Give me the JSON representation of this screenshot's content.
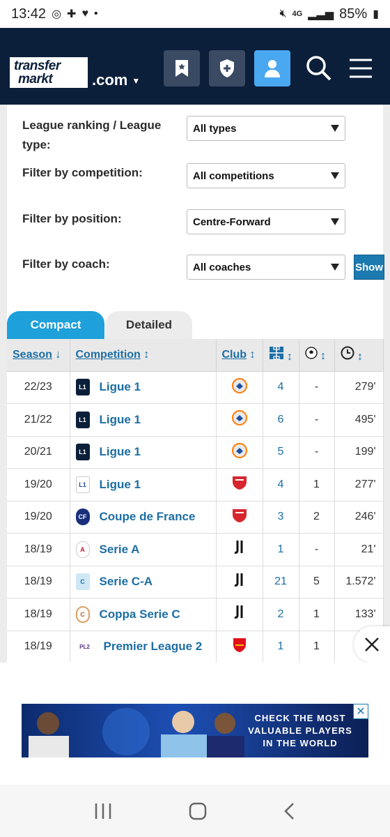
{
  "status_bar": {
    "time": "13:42",
    "network": "4G",
    "battery": "85%"
  },
  "header": {
    "logo_line1": "transfer",
    "logo_line2": "markt",
    "domain": ".com"
  },
  "filters": [
    {
      "label": "League ranking / League type:",
      "value": "All types"
    },
    {
      "label": "Filter by competition:",
      "value": "All competitions"
    },
    {
      "label": "Filter by position:",
      "value": "Centre-Forward"
    },
    {
      "label": "Filter by coach:",
      "value": "All coaches"
    }
  ],
  "show_button": "Show",
  "tabs": {
    "compact": "Compact",
    "detailed": "Detailed"
  },
  "table": {
    "headers": {
      "season": "Season",
      "competition": "Competition",
      "club": "Club"
    },
    "rows": [
      {
        "season": "22/23",
        "competition": "Ligue 1",
        "apps": "4",
        "goals": "-",
        "minutes": "279'"
      },
      {
        "season": "21/22",
        "competition": "Ligue 1",
        "apps": "6",
        "goals": "-",
        "minutes": "495'"
      },
      {
        "season": "20/21",
        "competition": "Ligue 1",
        "apps": "5",
        "goals": "-",
        "minutes": "199'"
      },
      {
        "season": "19/20",
        "competition": "Ligue 1",
        "apps": "4",
        "goals": "1",
        "minutes": "277'"
      },
      {
        "season": "19/20",
        "competition": "Coupe de France",
        "apps": "3",
        "goals": "2",
        "minutes": "246'"
      },
      {
        "season": "18/19",
        "competition": "Serie A",
        "apps": "1",
        "goals": "-",
        "minutes": "21'"
      },
      {
        "season": "18/19",
        "competition": "Serie C-A",
        "apps": "21",
        "goals": "5",
        "minutes": "1.572'"
      },
      {
        "season": "18/19",
        "competition": "Coppa Serie C",
        "apps": "2",
        "goals": "1",
        "minutes": "133'"
      },
      {
        "season": "18/19",
        "competition": "Premier League 2",
        "apps": "1",
        "goals": "1",
        "minutes": ""
      }
    ]
  },
  "ad": {
    "text_line1": "CHECK THE MOST",
    "text_line2": "VALUABLE PLAYERS",
    "text_line3": "IN THE WORLD"
  },
  "colors": {
    "header_bg": "#0b1f3a",
    "accent_blue": "#1ea0db",
    "link_blue": "#1c6ea4",
    "active_button": "#4aa8f0"
  }
}
